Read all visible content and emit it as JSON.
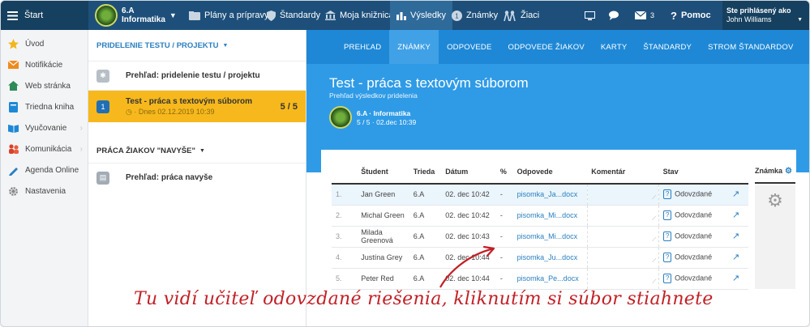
{
  "topbar": {
    "start": "Štart",
    "class_name": "6.A",
    "class_subject": "Informatika",
    "plans": "Plány a prípravy",
    "standards": "Štandardy",
    "library": "Moja knižnica",
    "results": "Výsledky",
    "grades": "Známky",
    "students": "Žiaci",
    "mail_count": "3",
    "help": "Pomoc",
    "user_label": "Ste prihlásený ako",
    "user_name": "John Williams"
  },
  "sidebar": {
    "items": [
      {
        "label": "Úvod"
      },
      {
        "label": "Notifikácie"
      },
      {
        "label": "Web stránka"
      },
      {
        "label": "Triedna kniha"
      },
      {
        "label": "Vyučovanie"
      },
      {
        "label": "Komunikácia"
      },
      {
        "label": "Agenda Online"
      },
      {
        "label": "Nastavenia"
      }
    ]
  },
  "middle": {
    "section1_title": "PRIDELENIE TESTU / PROJEKTU",
    "row1_label": "Prehľad: pridelenie testu / projektu",
    "row2_number": "1",
    "row2_title": "Test - práca s textovým súborom",
    "row2_sub": "· Dnes 02.12.2019 10:39",
    "row2_score": "5 / 5",
    "section2_title": "PRÁCA ŽIAKOV \"NAVYŠE\"",
    "row3_label": "Prehľad: práca navyše"
  },
  "tabs": [
    "PREHĽAD",
    "ZNÁMKY",
    "ODPOVEDE",
    "ODPOVEDE ŽIAKOV",
    "KARTY",
    "ŠTANDARDY",
    "STROM ŠTANDARDOV"
  ],
  "hero": {
    "title": "Test - práca s textovým súborom",
    "subtitle": "Prehľad výsledkov pridelenia",
    "class_line": "6.A · Informatika",
    "stats_line": "5 / 5 · 02.dec 10:39"
  },
  "table": {
    "headers": {
      "student": "Študent",
      "class": "Trieda",
      "date": "Dátum",
      "percent": "%",
      "answers": "Odpovede",
      "comment": "Komentár",
      "status": "Stav",
      "grade": "Známka"
    },
    "rows": [
      {
        "num": "1.",
        "student": "Jan Green",
        "class": "6.A",
        "date": "02. dec 10:42",
        "percent": "-",
        "file": "pisomka_Ja...docx",
        "status": "Odovzdané"
      },
      {
        "num": "2.",
        "student": "Michal Green",
        "class": "6.A",
        "date": "02. dec 10:42",
        "percent": "-",
        "file": "pisomka_Mi...docx",
        "status": "Odovzdané"
      },
      {
        "num": "3.",
        "student": "Milada Greenová",
        "class": "6.A",
        "date": "02. dec 10:43",
        "percent": "-",
        "file": "pisomka_Mi...docx",
        "status": "Odovzdané"
      },
      {
        "num": "4.",
        "student": "Justína Grey",
        "class": "6.A",
        "date": "02. dec 10:44",
        "percent": "-",
        "file": "pisomka_Ju...docx",
        "status": "Odovzdané"
      },
      {
        "num": "5.",
        "student": "Peter Red",
        "class": "6.A",
        "date": "02. dec 10:44",
        "percent": "-",
        "file": "pisomka_Pe...docx",
        "status": "Odovzdané"
      }
    ]
  },
  "annotation": "Tu vidí učiteľ odovzdané riešenia, kliknutím si súbor stiahnete",
  "colors": {
    "topbar": "#1d4f7a",
    "tabs": "#1e88d6",
    "hero": "#2f9be6",
    "selected_row": "#f6b81c",
    "annotation": "#c21f26"
  }
}
